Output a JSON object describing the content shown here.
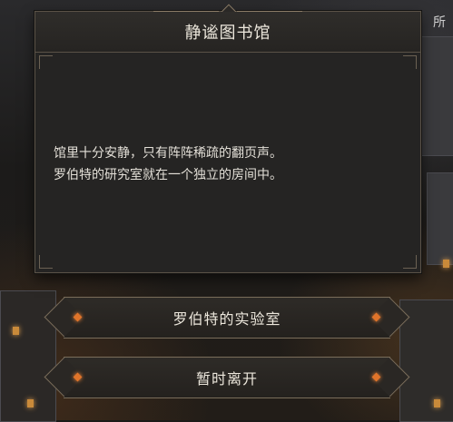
{
  "corner_label": "所",
  "dialog": {
    "title": "静谧图书馆",
    "body_lines": [
      "馆里十分安静，只有阵阵稀疏的翻页声。",
      "罗伯特的研究室就在一个独立的房间中。"
    ]
  },
  "choices": [
    {
      "label": "罗伯特的实验室"
    },
    {
      "label": "暂时离开"
    }
  ],
  "colors": {
    "panel": "#252423",
    "border": "#5a5247",
    "text": "#ece7dc",
    "gem": "#e0742a"
  }
}
